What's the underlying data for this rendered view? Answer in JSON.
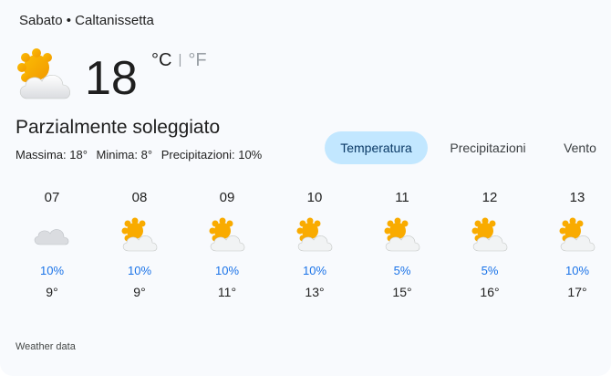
{
  "header": {
    "day": "Sabato",
    "separator": "•",
    "city": "Caltanissetta"
  },
  "current": {
    "temperature": "18",
    "unit_celsius": "°C",
    "unit_separator": "|",
    "unit_fahrenheit": "°F",
    "condition": "Parzialmente soleggiato",
    "icon": "partly-cloudy-icon",
    "details": {
      "max": "Massima: 18°",
      "min": "Minima: 8°",
      "precip": "Precipitazioni: 10%"
    }
  },
  "tabs": [
    {
      "label": "Temperatura",
      "active": true
    },
    {
      "label": "Precipitazioni",
      "active": false
    },
    {
      "label": "Vento",
      "active": false
    }
  ],
  "hours": [
    {
      "time": "07",
      "icon": "cloudy-icon",
      "precip": "10%",
      "temp": "9°"
    },
    {
      "time": "08",
      "icon": "partly-cloudy-icon",
      "precip": "10%",
      "temp": "9°"
    },
    {
      "time": "09",
      "icon": "partly-cloudy-icon",
      "precip": "10%",
      "temp": "11°"
    },
    {
      "time": "10",
      "icon": "partly-cloudy-icon",
      "precip": "10%",
      "temp": "13°"
    },
    {
      "time": "11",
      "icon": "partly-cloudy-icon",
      "precip": "5%",
      "temp": "15°"
    },
    {
      "time": "12",
      "icon": "partly-cloudy-icon",
      "precip": "5%",
      "temp": "16°"
    },
    {
      "time": "13",
      "icon": "partly-cloudy-icon",
      "precip": "10%",
      "temp": "17°"
    }
  ],
  "footer": {
    "source": "Weather data"
  },
  "colors": {
    "accent": "#1a73e8",
    "tab_active_bg": "#c2e7ff",
    "sun": "#f9ab00",
    "cloud": "#e8eaed"
  }
}
